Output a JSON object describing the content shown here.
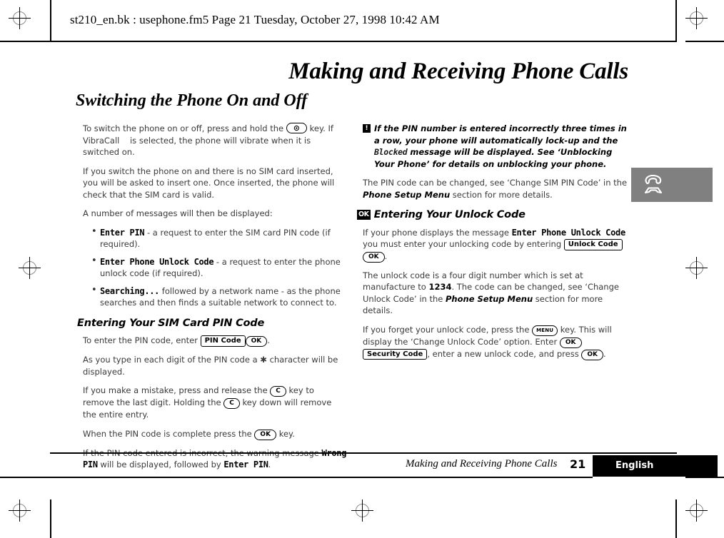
{
  "header": {
    "filename_line": "st210_en.bk : usephone.fm5  Page 21  Tuesday, October 27, 1998  10:42 AM"
  },
  "chapter_title": "Making and Receiving Phone Calls",
  "section_title": "Switching the Phone On and Off",
  "left_column": {
    "para_switch_1a": "To switch the phone on or off, press and hold the ",
    "key_power": "⊙",
    "para_switch_1b": " key. If VibraCall",
    "para_switch_1c": "is selected, the phone will vibrate when it is switched on.",
    "para_no_sim": "If you switch the phone on and there is no SIM card inserted, you will be asked to insert one. Once inserted, the phone will check that the SIM card is valid.",
    "para_messages_intro": "A number of messages will then be displayed:",
    "bullets": [
      {
        "lcd": "Enter PIN",
        "text": " - a request to enter the SIM card PIN code (if required)."
      },
      {
        "lcd": "Enter Phone Unlock Code",
        "text": " - a request to enter the phone unlock code (if required)."
      },
      {
        "lcd": "Searching...",
        "text": " followed by a network name - as the phone searches and then finds a suitable network to connect to."
      }
    ],
    "subhead_pin": "Entering Your SIM Card PIN Code",
    "para_enter_pin_a": "To enter the PIN code, enter ",
    "key_pin_code": "PIN Code",
    "key_ok_1": "OK",
    "para_enter_pin_b": ".",
    "para_star": "As you type in each digit of the PIN code a ✱ character will be displayed.",
    "para_mistake_a": "If you make a mistake, press and release the ",
    "key_c_1": "C",
    "para_mistake_b": " key to remove the last digit. Holding the ",
    "key_c_2": "C",
    "para_mistake_c": " key down will remove the entire entry.",
    "para_complete_a": "When the PIN code is complete press the ",
    "key_ok_2": "OK",
    "para_complete_b": " key.",
    "para_wrong_a": "If the PIN code entered is incorrect, the warning message ",
    "lcd_wrong_pin": "Wrong PIN",
    "para_wrong_b": " will be displayed, followed by ",
    "lcd_enter_pin": "Enter PIN",
    "para_wrong_c": "."
  },
  "right_column": {
    "warning_icon": "!",
    "warning_a": "If the PIN number is entered incorrectly three times in a row, your phone will automatically lock-up and the ",
    "warning_lcd": "Blocked",
    "warning_b": " message will be displayed. See ‘Unblocking Your Phone’ for details on unblocking your phone.",
    "para_change_a": "The PIN code can be changed, see ‘Change SIM PIN Code’ in the ",
    "para_change_ref": "Phone Setup Menu",
    "para_change_b": " section for more details.",
    "subhead_badge": "OK",
    "subhead_unlock": "Entering Your Unlock Code",
    "para_displays_a": "If your phone displays the message ",
    "lcd_enter_phone_unlock": "Enter Phone Unlock Code",
    "para_displays_b": " you must enter your unlocking code by entering ",
    "key_unlock_code": "Unlock Code",
    "key_ok_3": "OK",
    "para_displays_c": ".",
    "para_fourdigit_a": "The unlock code is a four digit number which is set at manufacture to ",
    "para_fourdigit_code": "1234",
    "para_fourdigit_b": ". The code can be changed, see ‘Change Unlock Code’ in the ",
    "para_fourdigit_ref": "Phone Setup Menu",
    "para_fourdigit_c": " section for more details.",
    "para_forget_a": "If you forget your unlock code, press the ",
    "key_menu": "MENU",
    "para_forget_b": " key. This will display the ‘Change Unlock Code’ option. Enter ",
    "key_ok_4": "OK",
    "key_security_code": "Security Code",
    "para_forget_c": ", enter a new unlock code, and press ",
    "key_ok_5": "OK",
    "para_forget_d": "."
  },
  "side_tab": {
    "icon": "phone-handset-icon",
    "color": "#808080"
  },
  "footer": {
    "running_title": "Making and Receiving Phone Calls",
    "page_number": "21",
    "language": "English"
  }
}
